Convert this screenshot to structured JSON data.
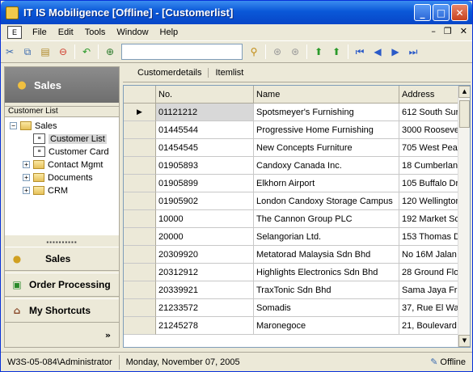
{
  "window": {
    "title": "IT IS Mobiligence [Offline] - [Customerlist]"
  },
  "menu": {
    "items": [
      "File",
      "Edit",
      "Tools",
      "Window",
      "Help"
    ]
  },
  "left": {
    "header": "Sales",
    "tree_title": "Customer List",
    "tree": [
      {
        "label": "Sales",
        "indent": 0,
        "type": "folder",
        "expander": "−"
      },
      {
        "label": "Customer List",
        "indent": 1,
        "type": "doc",
        "selected": true
      },
      {
        "label": "Customer Card",
        "indent": 1,
        "type": "doc"
      },
      {
        "label": "Contact Mgmt",
        "indent": 1,
        "type": "folder",
        "expander": "+"
      },
      {
        "label": "Documents",
        "indent": 1,
        "type": "folder",
        "expander": "+"
      },
      {
        "label": "CRM",
        "indent": 1,
        "type": "folder",
        "expander": "+"
      }
    ],
    "nav": [
      {
        "label": "Sales",
        "icon": "sales-icon"
      },
      {
        "label": "Order Processing",
        "icon": "order-processing-icon"
      },
      {
        "label": "My Shortcuts",
        "icon": "shortcuts-icon"
      }
    ],
    "more": "»"
  },
  "tabs": [
    "Customerdetails",
    "Itemlist"
  ],
  "grid": {
    "columns": [
      "No.",
      "Name",
      "Address"
    ],
    "rows": [
      [
        "01121212",
        "Spotsmeyer's Furnishing",
        "612 South Sur"
      ],
      [
        "01445544",
        "Progressive Home Furnishing",
        "3000 Roosevel"
      ],
      [
        "01454545",
        "New Concepts Furniture",
        "705 West Pea"
      ],
      [
        "01905893",
        "Candoxy Canada Inc.",
        "18 Cumberland"
      ],
      [
        "01905899",
        "Elkhorn Airport",
        "105 Buffalo Dr"
      ],
      [
        "01905902",
        "London Candoxy Storage Campus",
        "120 Wellington"
      ],
      [
        "10000",
        "The Cannon Group PLC",
        "192 Market Sc"
      ],
      [
        "20000",
        "Selangorian Ltd.",
        "153 Thomas D"
      ],
      [
        "20309920",
        "Metatorad Malaysia Sdn Bhd",
        "No 16M Jalan"
      ],
      [
        "20312912",
        "Highlights Electronics Sdn Bhd",
        "28 Ground Flo"
      ],
      [
        "20339921",
        "TraxTonic Sdn Bhd",
        "Sama Jaya Fre"
      ],
      [
        "21233572",
        "Somadis",
        "37, Rue El Wa"
      ],
      [
        "21245278",
        "Maronegoce",
        "21, Boulevard"
      ]
    ],
    "selected_row": 0
  },
  "status": {
    "user": "W3S-05-084\\Administrator",
    "date": "Monday, November 07, 2005",
    "mode": "Offline"
  }
}
